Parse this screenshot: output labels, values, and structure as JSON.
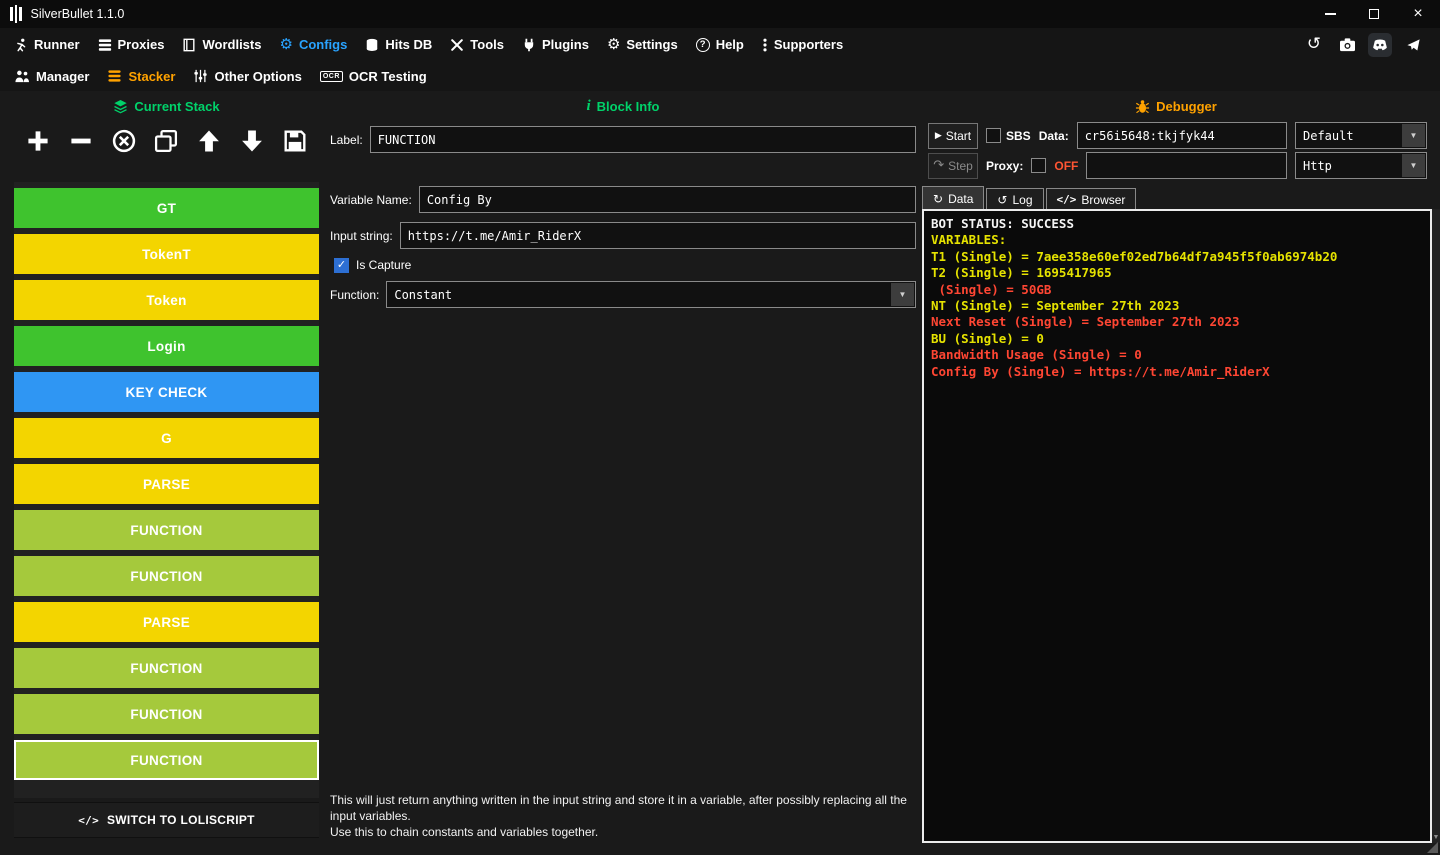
{
  "titlebar": {
    "title": "SilverBullet 1.1.0"
  },
  "menu": {
    "active_color": "#29a3ff",
    "items": [
      {
        "label": "Runner"
      },
      {
        "label": "Proxies"
      },
      {
        "label": "Wordlists"
      },
      {
        "label": "Configs"
      },
      {
        "label": "Hits DB"
      },
      {
        "label": "Tools"
      },
      {
        "label": "Plugins"
      },
      {
        "label": "Settings"
      },
      {
        "label": "Help"
      },
      {
        "label": "Supporters"
      }
    ]
  },
  "submenu": {
    "active_color": "#ffa200",
    "items": [
      {
        "label": "Manager"
      },
      {
        "label": "Stacker"
      },
      {
        "label": "Other Options"
      },
      {
        "label": "OCR Testing"
      }
    ]
  },
  "stack_panel": {
    "title": "Current Stack",
    "title_color": "#00d26a",
    "switch_button": "SWITCH TO LOLISCRIPT",
    "blocks": [
      {
        "label": "GT",
        "color": "#3fc32e"
      },
      {
        "label": "TokenT",
        "color": "#f3d500"
      },
      {
        "label": "Token",
        "color": "#f3d500"
      },
      {
        "label": "Login",
        "color": "#3fc32e"
      },
      {
        "label": "KEY CHECK",
        "color": "#2f96f3"
      },
      {
        "label": "G",
        "color": "#f3d500"
      },
      {
        "label": "PARSE",
        "color": "#f3d500"
      },
      {
        "label": "FUNCTION",
        "color": "#a5c93c"
      },
      {
        "label": "FUNCTION",
        "color": "#a5c93c"
      },
      {
        "label": "PARSE",
        "color": "#f3d500"
      },
      {
        "label": "FUNCTION",
        "color": "#a5c93c"
      },
      {
        "label": "FUNCTION",
        "color": "#a5c93c"
      },
      {
        "label": "FUNCTION",
        "color": "#a5c93c",
        "selected": true
      }
    ]
  },
  "block_info": {
    "title": "Block Info",
    "title_color": "#00d26a",
    "label_label": "Label:",
    "label_value": "FUNCTION",
    "variable_name_label": "Variable Name:",
    "variable_name_value": "Config By",
    "input_string_label": "Input string:",
    "input_string_value": "https://t.me/Amir_RiderX",
    "is_capture_label": "Is Capture",
    "is_capture_checked": true,
    "function_label": "Function:",
    "function_value": "Constant",
    "description_line1": "This will just return anything written in the input string and store it in a variable, after possibly replacing all the input variables.",
    "description_line2": "Use this to chain constants and variables together."
  },
  "debugger": {
    "title": "Debugger",
    "title_color": "#ffa200",
    "start_button": "Start",
    "step_button": "Step",
    "sbs_label": "SBS",
    "data_label": "Data:",
    "data_value": "cr56i5648:tkjfyk44",
    "wordlist_select": "Default",
    "proxy_label": "Proxy:",
    "proxy_status": "OFF",
    "proxy_status_color": "#ff5533",
    "proxy_input_value": "",
    "proxy_select": "Http",
    "tabs": [
      {
        "label": "Data"
      },
      {
        "label": "Log"
      },
      {
        "label": "Browser"
      }
    ],
    "active_tab": "Data",
    "console_lines": [
      {
        "text": "BOT STATUS: SUCCESS",
        "color": "#f5f5f5"
      },
      {
        "text": "VARIABLES:",
        "color": "#e6e300"
      },
      {
        "text": "T1 (Single) = 7aee358e60ef02ed7b64df7a945f5f0ab6974b20",
        "color": "#e6e300"
      },
      {
        "text": "T2 (Single) = 1695417965",
        "color": "#e6e300"
      },
      {
        "text": " (Single) = 50GB",
        "color": "#ff4633"
      },
      {
        "text": "NT (Single) = September 27th 2023",
        "color": "#e6e300"
      },
      {
        "text": "Next Reset (Single) = September 27th 2023",
        "color": "#ff4633"
      },
      {
        "text": "BU (Single) = 0",
        "color": "#e6e300"
      },
      {
        "text": "Bandwidth Usage (Single) = 0",
        "color": "#ff4633"
      },
      {
        "text": "Config By (Single) = https://t.me/Amir_RiderX",
        "color": "#ff4633"
      }
    ]
  },
  "icons": {
    "gear": "⚙",
    "history": "↺",
    "play": "▶",
    "step": "↷",
    "dropdown_arrow": "▼",
    "check": "✓",
    "data_tab": "↻",
    "log_tab": "↺",
    "code": "</>",
    "help": "?",
    "scroll_down": "▼",
    "ocr": "OCR"
  }
}
